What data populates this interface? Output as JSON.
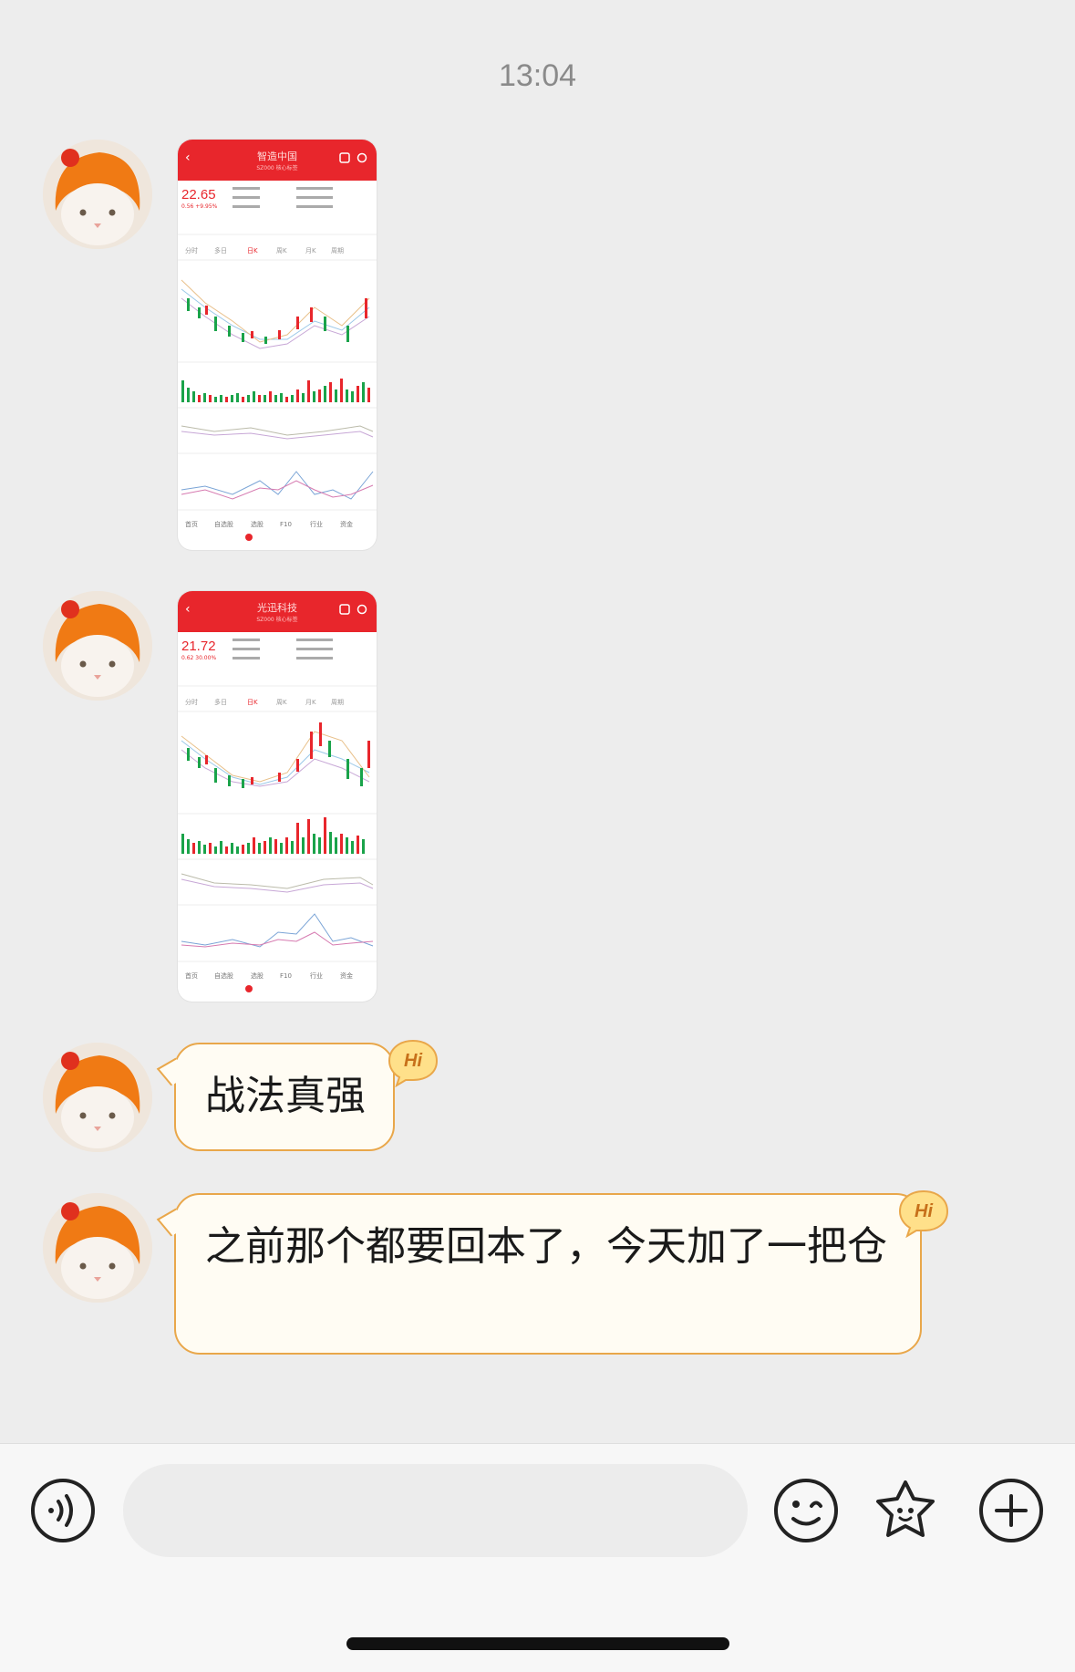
{
  "chat": {
    "timestamp": "13:04",
    "messages": [
      {
        "type": "image",
        "stock": {
          "name": "智造中国",
          "subtitle": "SZ000 核心标签",
          "price": "22.65",
          "change": "0.56 +9.95%"
        }
      },
      {
        "type": "image",
        "stock": {
          "name": "光迅科技",
          "subtitle": "SZ000 核心标签",
          "price": "21.72",
          "change": "0.62 30.00%"
        }
      },
      {
        "type": "text",
        "text": "战法真强",
        "badge": "Hi"
      },
      {
        "type": "text",
        "text": "之前那个都要回本了，今天加了一把仓",
        "badge": "Hi"
      }
    ]
  },
  "input_bar": {
    "voice_icon": "voice-icon",
    "emoji_icon": "emoji-icon",
    "sticker_icon": "sticker-icon",
    "add_icon": "plus-icon",
    "placeholder": ""
  }
}
